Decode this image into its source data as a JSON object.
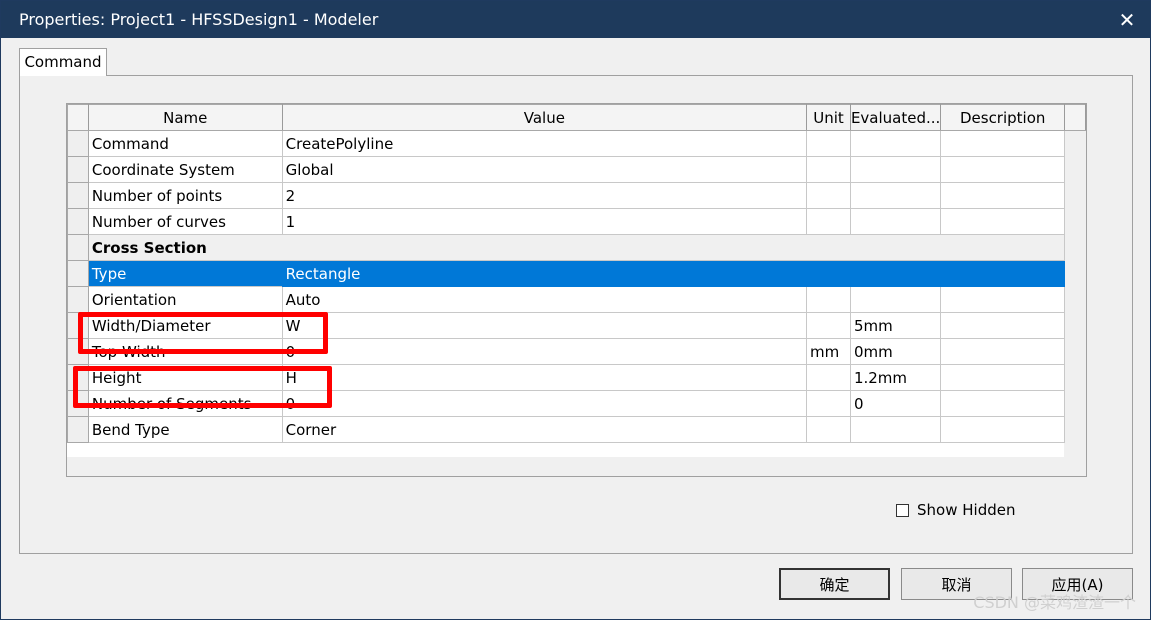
{
  "window": {
    "title": "Properties: Project1 - HFSSDesign1 - Modeler",
    "close_glyph": "✕"
  },
  "tabs": [
    {
      "label": "Command",
      "selected": true
    }
  ],
  "grid": {
    "columns": [
      "Name",
      "Value",
      "Unit",
      "Evaluated...",
      "Description"
    ],
    "rows": [
      {
        "name": "Command",
        "value": "CreatePolyline",
        "unit": "",
        "evaluated": "",
        "description": ""
      },
      {
        "name": "Coordinate System",
        "value": "Global",
        "unit": "",
        "evaluated": "",
        "description": ""
      },
      {
        "name": "Number of points",
        "value": "2",
        "unit": "",
        "evaluated": "",
        "description": ""
      },
      {
        "name": "Number of curves",
        "value": "1",
        "unit": "",
        "evaluated": "",
        "description": ""
      },
      {
        "section": "Cross Section"
      },
      {
        "name": "Type",
        "value": "Rectangle",
        "unit": "",
        "evaluated": "",
        "description": "",
        "selected": true
      },
      {
        "name": "Orientation",
        "value": "Auto",
        "unit": "",
        "evaluated": "",
        "description": ""
      },
      {
        "name": "Width/Diameter",
        "value": "W",
        "unit": "",
        "evaluated": "5mm",
        "description": ""
      },
      {
        "name": "Top Width",
        "value": "0",
        "unit": "mm",
        "evaluated": "0mm",
        "description": ""
      },
      {
        "name": "Height",
        "value": "H",
        "unit": "",
        "evaluated": "1.2mm",
        "description": ""
      },
      {
        "name": "Number of Segments",
        "value": "0",
        "unit": "",
        "evaluated": "0",
        "description": ""
      },
      {
        "name": "Bend Type",
        "value": "Corner",
        "unit": "",
        "evaluated": "",
        "description": ""
      }
    ]
  },
  "show_hidden": {
    "label": "Show Hidden",
    "checked": false
  },
  "buttons": {
    "ok": "确定",
    "cancel": "取消",
    "apply": "应用(A)"
  },
  "watermark": "CSDN @菜鸡渣渣一个",
  "colors": {
    "titlebar": "#1e3a5c",
    "selection": "#0078d7",
    "annotation": "#ff0000"
  }
}
